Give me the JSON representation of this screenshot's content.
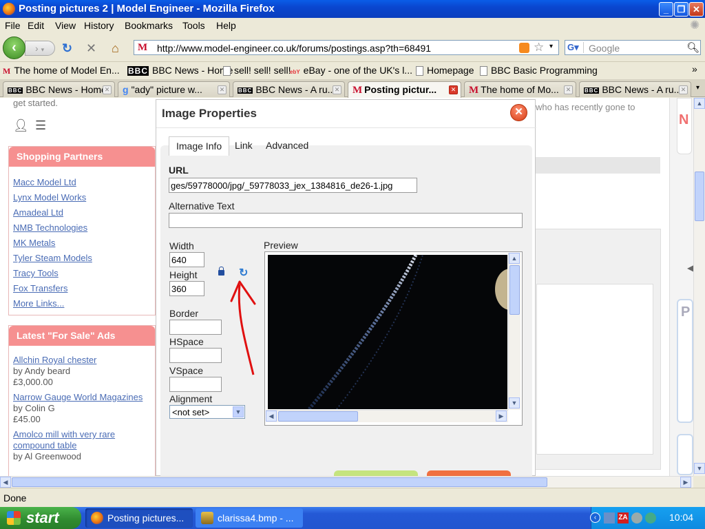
{
  "window": {
    "title": "Posting pictures 2 | Model Engineer - Mozilla Firefox"
  },
  "menu": [
    "File",
    "Edit",
    "View",
    "History",
    "Bookmarks",
    "Tools",
    "Help"
  ],
  "nav": {
    "url": "http://www.model-engineer.co.uk/forums/postings.asp?th=68491",
    "search_placeholder": "Google"
  },
  "bookmarks": [
    "The home of Model En...",
    "BBC News - Home",
    "sell! sell! sell!",
    "eBay - one of the UK's l...",
    "Homepage",
    "BBC Basic Programming"
  ],
  "tabs": [
    "BBC News - Home",
    "\"ady\" picture w...",
    "BBC News - A ru...",
    "Posting pictur...",
    "The home of Mo...",
    "BBC News - A ru..."
  ],
  "page": {
    "get_started": "get started.",
    "bg_text": "who has recently gone to",
    "shopping_title": "Shopping Partners",
    "shopping_links": [
      "Macc Model Ltd",
      "Lynx Model Works",
      "Amadeal Ltd",
      "NMB Technologies",
      "MK Metals",
      "Tyler Steam Models",
      "Tracy Tools",
      "Fox Transfers",
      "More Links..."
    ],
    "forsale_title": "Latest \"For Sale\" Ads",
    "ads": [
      {
        "title": "Allchin Royal chester",
        "by": "by Andy beard",
        "price": "£3,000.00"
      },
      {
        "title": "Narrow Gauge World Magazines",
        "by": "by Colin G",
        "price": "£45.00"
      },
      {
        "title": "Amolco mill with very rare compound table",
        "by": "by Al Greenwood",
        "price": ""
      }
    ]
  },
  "dialog": {
    "title": "Image Properties",
    "tabs": [
      "Image Info",
      "Link",
      "Advanced"
    ],
    "url_label": "URL",
    "url_value": "ges/59778000/jpg/_59778033_jex_1384816_de26-1.jpg",
    "alt_label": "Alternative Text",
    "alt_value": "",
    "width_label": "Width",
    "width_value": "640",
    "height_label": "Height",
    "height_value": "360",
    "border_label": "Border",
    "hspace_label": "HSpace",
    "vspace_label": "VSpace",
    "alignment_label": "Alignment",
    "alignment_value": "<not set>",
    "preview_label": "Preview"
  },
  "status": "Done",
  "taskbar": {
    "start": "start",
    "tasks": [
      "Posting pictures...",
      "clarissa4.bmp - ..."
    ],
    "clock": "10:04"
  },
  "colors": {
    "accent_red": "#f69090",
    "link": "#4a6cb5",
    "arrow": "#e01010"
  }
}
